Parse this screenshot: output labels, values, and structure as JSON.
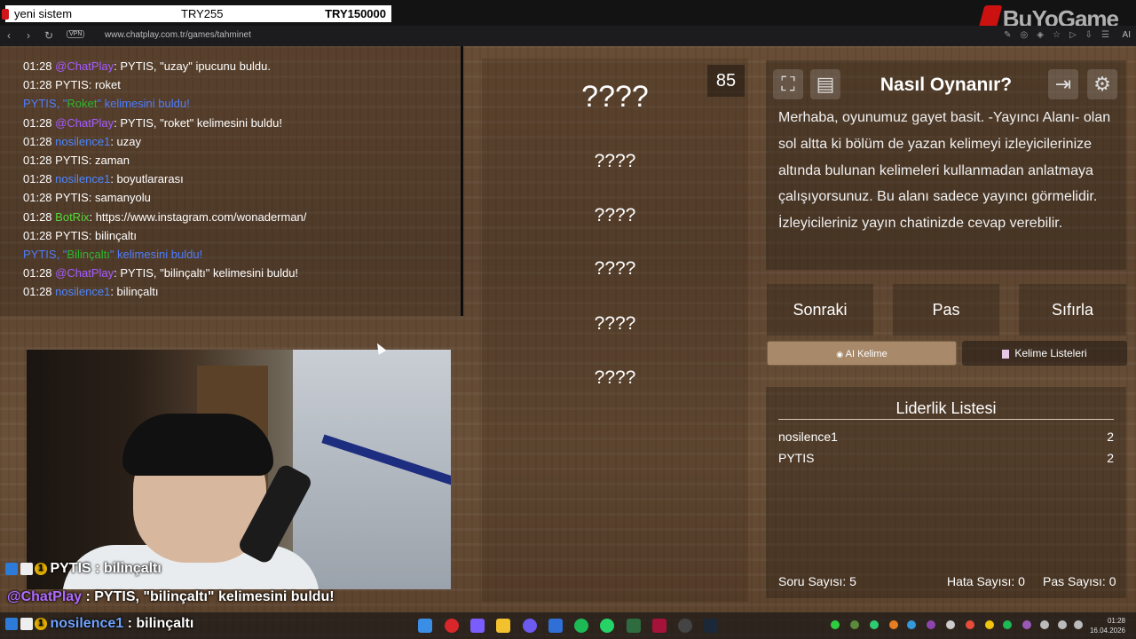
{
  "ticker": {
    "label": "yeni sistem",
    "amount_small": "TRY255",
    "amount_large": "TRY150000"
  },
  "watermark": "BuYoGame",
  "browser": {
    "vpn_label": "VPN",
    "url": "www.chatplay.com.tr/games/tahminet",
    "ai_label": "AI"
  },
  "chat": {
    "lines": [
      {
        "time": "01:28",
        "user": "@ChatPlay",
        "user_kind": "chatplay",
        "text": ": PYTIS, \"uzay\" ipucunu buldu."
      },
      {
        "time": "01:28",
        "user": "PYTIS",
        "user_kind": "plain",
        "text": ": roket"
      },
      {
        "system_prefix": "PYTIS, \"",
        "system_word": "Roket",
        "system_suffix": "\" kelimesini buldu!"
      },
      {
        "time": "01:28",
        "user": "@ChatPlay",
        "user_kind": "chatplay",
        "text": ": PYTIS, \"roket\" kelimesini buldu!"
      },
      {
        "time": "01:28",
        "user": "nosilence1",
        "user_kind": "nosilence",
        "text": ": uzay"
      },
      {
        "time": "01:28",
        "user": "PYTIS",
        "user_kind": "plain",
        "text": ": zaman"
      },
      {
        "time": "01:28",
        "user": "nosilence1",
        "user_kind": "nosilence",
        "text": ": boyutlararası"
      },
      {
        "time": "01:28",
        "user": "PYTIS",
        "user_kind": "plain",
        "text": ": samanyolu"
      },
      {
        "time": "01:28",
        "user": "BotRix",
        "user_kind": "botrix",
        "text": ": https://www.instagram.com/wonaderman/"
      },
      {
        "time": "01:28",
        "user": "PYTIS",
        "user_kind": "plain",
        "text": ": bilinçaltı"
      },
      {
        "system_prefix": "PYTIS, \"",
        "system_word": "Bilinçaltı",
        "system_suffix": "\" kelimesini buldu!"
      },
      {
        "time": "01:28",
        "user": "@ChatPlay",
        "user_kind": "chatplay",
        "text": ": PYTIS, \"bilinçaltı\" kelimesini buldu!"
      },
      {
        "time": "01:28",
        "user": "nosilence1",
        "user_kind": "nosilence",
        "text": ": bilinçaltı"
      }
    ]
  },
  "overlay_chat": {
    "line1_user": "PYTIS",
    "line1_text": ": bilinçaltı",
    "line2_user": "@ChatPlay",
    "line2_text": ": PYTIS, \"bilinçaltı\" kelimesini buldu!",
    "line3_user": "nosilence1",
    "line3_text": ": bilinçaltı",
    "badge_number": "1"
  },
  "game": {
    "score": "85",
    "words": [
      "????",
      "????",
      "????",
      "????",
      "????",
      "????"
    ]
  },
  "howto": {
    "title": "Nasıl Oynanır?",
    "body": "Merhaba, oyunumuz gayet basit. -Yayıncı Alanı- olan sol altta ki bölüm de yazan kelimeyi izleyicilerinize altında bulunan kelimeleri kullanmadan anlatmaya çalışıyorsunuz. Bu alanı sadece yayıncı görmelidir. İzleyicileriniz yayın chatinizde cevap verebilir."
  },
  "actions": {
    "next": "Sonraki",
    "pass": "Pas",
    "reset": "Sıfırla"
  },
  "tabs": {
    "ai_word": "AI Kelime",
    "word_lists": "Kelime Listeleri"
  },
  "leaderboard": {
    "title": "Liderlik Listesi",
    "rows": [
      {
        "name": "nosilence1",
        "score": "2"
      },
      {
        "name": "PYTIS",
        "score": "2"
      }
    ]
  },
  "stats": {
    "questions": "Soru Sayısı: 5",
    "errors": "Hata Sayısı: 0",
    "passes": "Pas Sayısı: 0"
  },
  "clock": {
    "time": "01:28",
    "date": "16.04.2026"
  },
  "icons": [
    "fullscreen-icon",
    "notes-icon",
    "exit-icon",
    "gear-icon",
    "back-icon",
    "reload-icon"
  ],
  "colors": {
    "chatplay": "#a55cff",
    "nosilence": "#4d86ff",
    "botrix": "#54d93b",
    "system": "#4d7dff",
    "ai_tab": "#a88a6b"
  }
}
